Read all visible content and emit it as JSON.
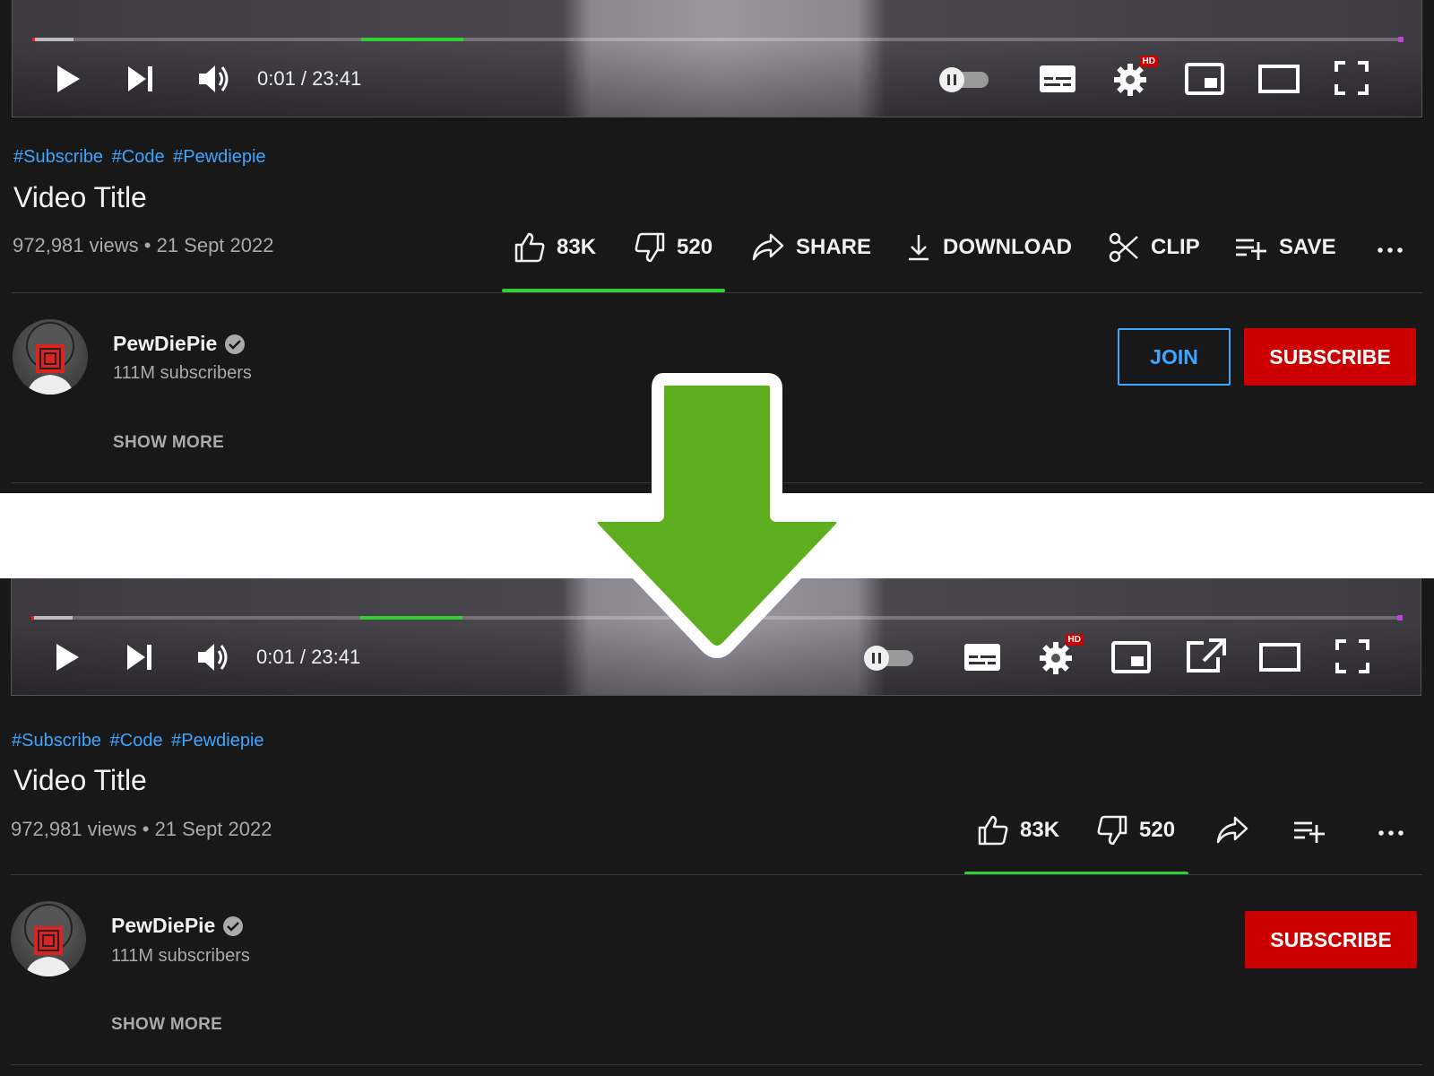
{
  "player": {
    "time_display": "0:01 / 23:41",
    "hd_badge": "HD",
    "icons": [
      "play-icon",
      "next-icon",
      "volume-icon",
      "autoplay-toggle",
      "subtitles-icon",
      "settings-icon",
      "miniplayer-icon",
      "popout-icon",
      "theater-icon",
      "fullscreen-icon"
    ]
  },
  "video": {
    "hashtags": [
      "#Subscribe",
      "#Code",
      "#Pewdiepie"
    ],
    "title": "Video Title",
    "meta": "972,981 views • 21 Sept 2022"
  },
  "actions": {
    "like_count": "83K",
    "dislike_count": "520",
    "share_label": "SHARE",
    "download_label": "DOWNLOAD",
    "clip_label": "CLIP",
    "save_label": "SAVE",
    "more_label": "..."
  },
  "channel": {
    "name": "PewDiePie",
    "subscribers": "111M subscribers",
    "join_label": "JOIN",
    "subscribe_label": "SUBSCRIBE",
    "show_more": "SHOW MORE"
  },
  "colors": {
    "background": "#181818",
    "link": "#3ea6ff",
    "subscribe": "#cc0000",
    "highlight": "#2fd02f",
    "arrow": "#5fae1f"
  }
}
